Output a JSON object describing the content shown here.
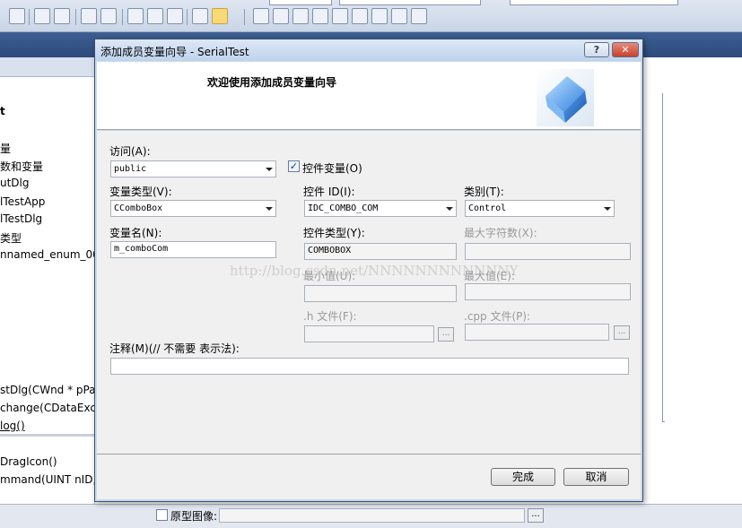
{
  "dialog": {
    "title": "添加成员变量向导 - SerialTest",
    "help_btn": "?",
    "close_btn": "✕",
    "welcome": "欢迎使用添加成员变量向导"
  },
  "form": {
    "access": {
      "label": "访问(A):",
      "value": "public"
    },
    "control_var": {
      "label": "控件变量(O)",
      "checked": true
    },
    "var_type": {
      "label": "变量类型(V):",
      "value": "CComboBox"
    },
    "control_id": {
      "label": "控件 ID(I):",
      "value": "IDC_COMBO_COM"
    },
    "category": {
      "label": "类别(T):",
      "value": "Control"
    },
    "var_name": {
      "label": "变量名(N):",
      "value": "m_comboCom"
    },
    "control_type": {
      "label": "控件类型(Y):",
      "value": "COMBOBOX"
    },
    "max_chars": {
      "label": "最大字符数(X):"
    },
    "min_value": {
      "label": "最小值(U):"
    },
    "max_value": {
      "label": "最大值(E):"
    },
    "h_file": {
      "label": ".h 文件(F):"
    },
    "cpp_file": {
      "label": ".cpp 文件(P):"
    },
    "browse": "...",
    "comment": {
      "label": "注释(M)(// 不需要 表示法):"
    }
  },
  "buttons": {
    "finish": "完成",
    "cancel": "取消"
  },
  "watermark": "http://blog.csdn.net/NNNNNNNNNNNNY",
  "left_panel": {
    "items": [
      "t",
      "量",
      "数和变量",
      "utDlg",
      "lTestApp",
      "lTestDlg",
      "类型",
      "nnamed_enum_00"
    ],
    "methods": [
      "stDlg(CWnd * pPa",
      "change(CDataExcl",
      "log()",
      "DragIcon()",
      "mmand(UINT nID,"
    ]
  },
  "bottom": {
    "prototype_label": "原型图像:"
  }
}
